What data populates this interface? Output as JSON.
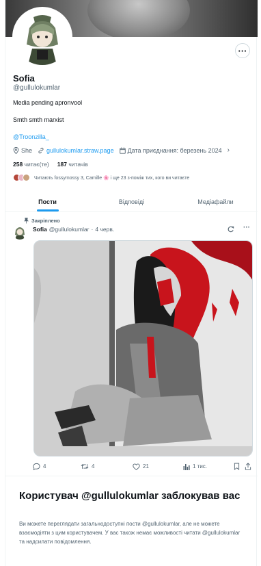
{
  "profile": {
    "name": "Sofia",
    "handle": "@gullulokumlar",
    "bio_line1": "Media pending apronvool",
    "bio_line2": "Smth smth marxist",
    "bio_mention": "@Troonzilla_",
    "location": "She",
    "website": "gullulokumlar.straw.page",
    "joined": "Дата приєднання: березень 2024",
    "following_count": "258",
    "following_label": "читає(те)",
    "followers_count": "187",
    "followers_label": "читачів",
    "known_followers": "Читають fossymossy 3, Camille 🌸 і ще 23 з-поміж тих, кого ви читаєте",
    "more_icon": "ellipsis-icon"
  },
  "tabs": [
    {
      "label": "Пости",
      "active": true
    },
    {
      "label": "Відповіді",
      "active": false
    },
    {
      "label": "Медіафайли",
      "active": false
    }
  ],
  "post": {
    "pinned_label": "Закріплено",
    "author_name": "Sofia",
    "author_handle": "@gullulokumlar",
    "separator": "·",
    "date": "4 черв.",
    "replies": "4",
    "reposts": "4",
    "likes": "21",
    "views": "1 тис."
  },
  "blocked": {
    "title": "Користувач @gullulokumlar заблокував вас",
    "text": "Ви можете переглядати загальнодоступні пости @gullulokumlar, але не можете взаємодіяти з цим користувачем. У вас також немає можливості читати @gullulokumlar та надсилати повідомлення."
  },
  "colors": {
    "accent": "#1d9bf0",
    "secondary_text": "#536471",
    "border": "#eff3f4",
    "blood_red": "#c8141c"
  }
}
